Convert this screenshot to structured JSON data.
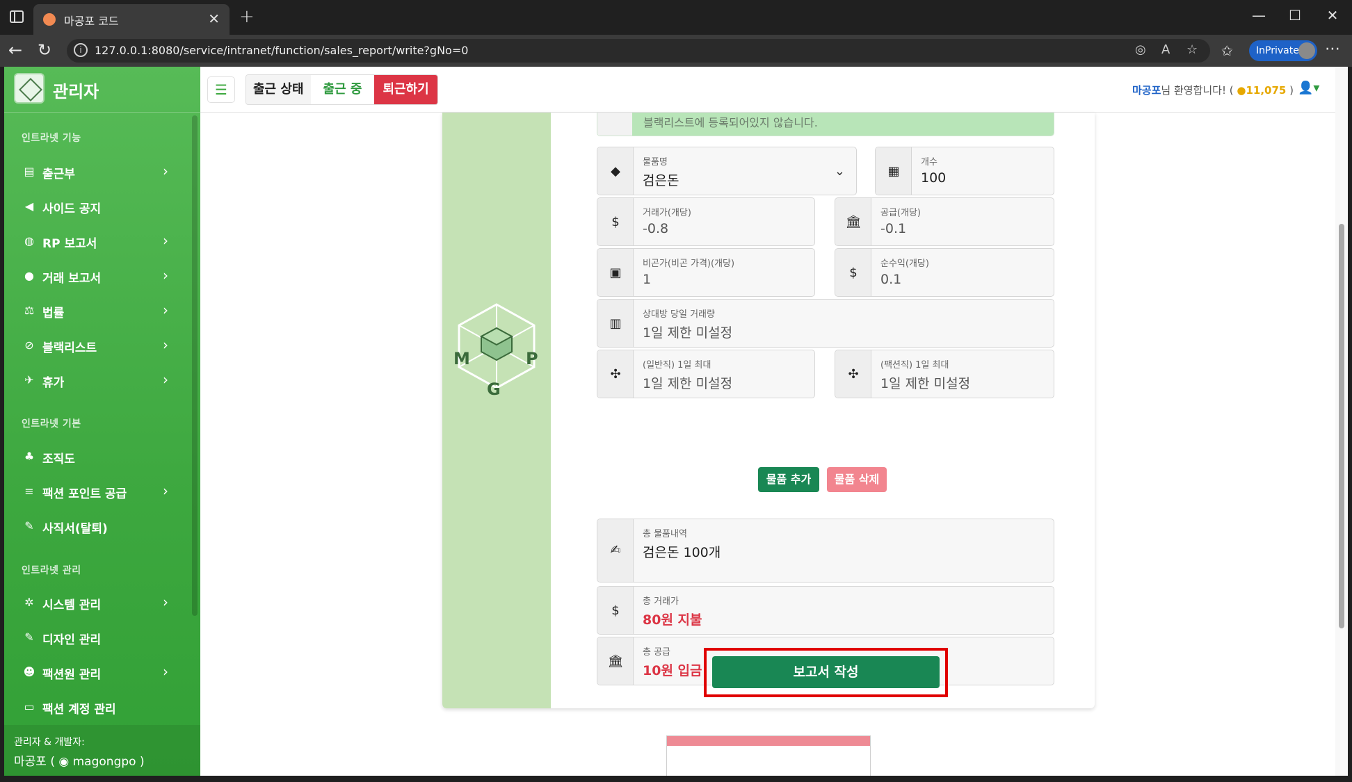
{
  "browser": {
    "tab_title": "마공포 코드",
    "url": "127.0.0.1:8080/service/intranet/function/sales_report/write?gNo=0",
    "inprivate_label": "InPrivate"
  },
  "sidebar": {
    "brand": "관리자",
    "sections": [
      {
        "label": "인트라넷 기능"
      },
      {
        "label": "인트라넷 기본"
      },
      {
        "label": "인트라넷 관리"
      }
    ],
    "items": [
      {
        "label": "출근부",
        "icon": "clipboard-icon"
      },
      {
        "label": "사이드 공지",
        "icon": "megaphone-icon"
      },
      {
        "label": "RP 보고서",
        "icon": "gamepad-icon"
      },
      {
        "label": "거래 보고서",
        "icon": "money-bag-icon"
      },
      {
        "label": "법률",
        "icon": "scale-icon"
      },
      {
        "label": "블랙리스트",
        "icon": "ban-icon"
      },
      {
        "label": "휴가",
        "icon": "plane-icon"
      },
      {
        "label": "조직도",
        "icon": "sitemap-icon"
      },
      {
        "label": "팩션 포인트 공급",
        "icon": "coins-icon"
      },
      {
        "label": "사직서(탈퇴)",
        "icon": "pen-icon"
      },
      {
        "label": "시스템 관리",
        "icon": "gear-icon"
      },
      {
        "label": "디자인 관리",
        "icon": "brush-icon"
      },
      {
        "label": "팩션원 관리",
        "icon": "users-icon"
      },
      {
        "label": "팩션 계정 관리",
        "icon": "id-card-icon"
      }
    ],
    "footer_line1": "관리자 & 개발자:",
    "footer_line2": "마공포 ( ",
    "footer_discord": "magongpo",
    "footer_close": " )"
  },
  "topbar": {
    "attendance_status": "출근 상태",
    "attendance_working": "출근 중",
    "leave_button": "퇴근하기",
    "welcome_name": "마공포",
    "welcome_text": "님 환영합니다! (",
    "points": "11,075",
    "points_close": " )"
  },
  "form": {
    "alert_partial": "블랙리스트에 등록되어있지 않습니다.",
    "item_name": {
      "label": "물품명",
      "value": "검은돈"
    },
    "count": {
      "label": "개수",
      "value": "100"
    },
    "trade_price": {
      "label": "거래가(개당)",
      "value": "-0.8"
    },
    "supply": {
      "label": "공급(개당)",
      "value": "-0.1"
    },
    "bigon_price": {
      "label": "비곤가(비곤 가격)(개당)",
      "value": "1"
    },
    "net_profit": {
      "label": "순수익(개당)",
      "value": "0.1"
    },
    "partner_daily": {
      "label": "상대방 당일 거래량",
      "value": "1일 제한 미설정"
    },
    "general_max": {
      "label": "(일반직) 1일 최대",
      "value": "1일 제한 미설정"
    },
    "faction_max": {
      "label": "(팩션직) 1일 최대",
      "value": "1일 제한 미설정"
    },
    "add_button": "물품 추가",
    "delete_button": "물품 삭제",
    "total_items": {
      "label": "총 물품내역",
      "value": "검은돈 100개"
    },
    "total_trade": {
      "label": "총 거래가",
      "value": "80원 지불"
    },
    "total_supply": {
      "label": "총 공급",
      "value": "10원 입금"
    },
    "submit_button": "보고서 작성"
  },
  "colors": {
    "sidebar_green": "#3da83f",
    "primary_green": "#198754",
    "danger_red": "#dc3545",
    "highlight_red": "#e00000"
  }
}
